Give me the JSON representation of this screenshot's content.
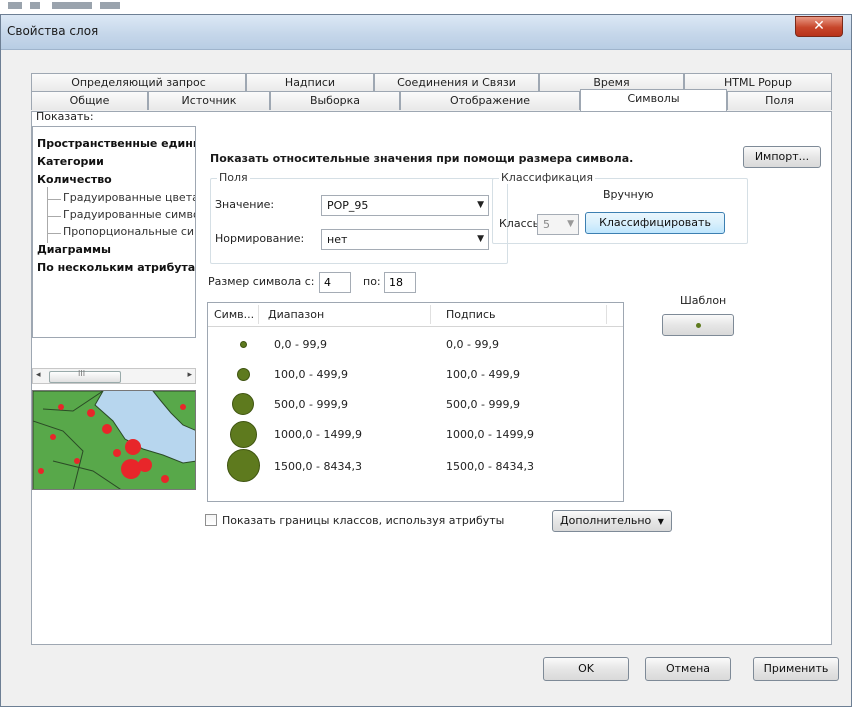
{
  "window": {
    "title": "Свойства слоя"
  },
  "tabs_row1": [
    "Определяющий запрос",
    "Надписи",
    "Соединения и Связи",
    "Время",
    "HTML Popup"
  ],
  "tabs_row2": [
    "Общие",
    "Источник",
    "Выборка",
    "Отображение",
    "Символы",
    "Поля"
  ],
  "active_tab": "Символы",
  "show": {
    "label": "Показать:",
    "items": [
      {
        "label": "Пространственные единицы",
        "level": 0
      },
      {
        "label": "Категории",
        "level": 0
      },
      {
        "label": "Количество",
        "level": 0
      },
      {
        "label": "Градуированные цвета",
        "level": 1
      },
      {
        "label": "Градуированные символы",
        "level": 1
      },
      {
        "label": "Пропорциональные символы",
        "level": 1
      },
      {
        "label": "Диаграммы",
        "level": 0
      },
      {
        "label": "По нескольким атрибутам",
        "level": 0
      }
    ],
    "scroll_mark": "III"
  },
  "main": {
    "heading": "Показать относительные значения при помощи размера символа.",
    "import_button": "Импорт...",
    "fields": {
      "title": "Поля",
      "value_label": "Значение:",
      "value": "POP_95",
      "norm_label": "Нормирование:",
      "norm_value": "нет"
    },
    "classification": {
      "title": "Классификация",
      "method": "Вручную",
      "classes_label": "Классы:",
      "classes_value": "5",
      "classify_button": "Классифицировать"
    },
    "symbol_size": {
      "label_from": "Размер символа с:",
      "from": "4",
      "label_to": "по:",
      "to": "18"
    },
    "template": {
      "title": "Шаблон"
    },
    "table": {
      "columns": [
        "Симв...",
        "Диапазон",
        "Подпись"
      ],
      "rows": [
        {
          "range": "0,0 - 99,9",
          "label": "0,0 - 99,9"
        },
        {
          "range": "100,0 - 499,9",
          "label": "100,0 - 499,9"
        },
        {
          "range": "500,0 - 999,9",
          "label": "500,0 - 999,9"
        },
        {
          "range": "1000,0 - 1499,9",
          "label": "1000,0 - 1499,9"
        },
        {
          "range": "1500,0 - 8434,3",
          "label": "1500,0 - 8434,3"
        }
      ]
    },
    "show_class_ranges": "Показать границы классов, используя атрибуты",
    "advanced_button": "Дополнительно"
  },
  "footer": {
    "ok": "OK",
    "cancel": "Отмена",
    "apply": "Применить"
  },
  "colors": {
    "symbol_fill": "#5e7a1e",
    "map_points": "#e8262a",
    "map_water": "#b7d6ee",
    "map_land": "#58a84a"
  }
}
